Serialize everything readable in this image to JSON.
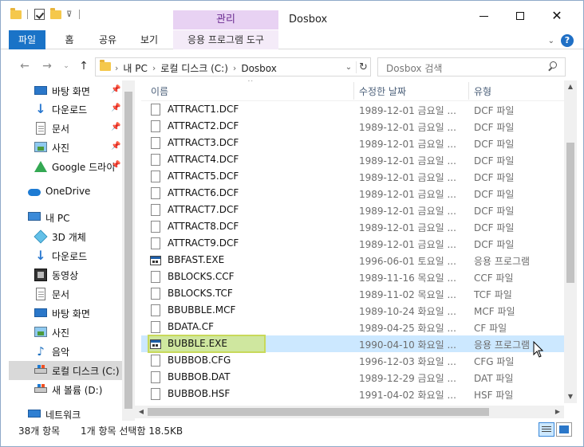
{
  "window": {
    "title": "Dosbox",
    "context_group": "관리"
  },
  "ribbon": {
    "tabs": [
      {
        "label": "파일",
        "active": true
      },
      {
        "label": "홈"
      },
      {
        "label": "공유"
      },
      {
        "label": "보기"
      },
      {
        "label": "응용 프로그램 도구"
      }
    ]
  },
  "address": {
    "crumbs": [
      "내 PC",
      "로컬 디스크 (C:)",
      "Dosbox"
    ]
  },
  "search": {
    "placeholder": "Dosbox 검색"
  },
  "navpane": {
    "quick_access": [
      {
        "label": "바탕 화면",
        "icon": "desktop-icon",
        "pinned": true
      },
      {
        "label": "다운로드",
        "icon": "download-icon",
        "pinned": true
      },
      {
        "label": "문서",
        "icon": "document-icon",
        "pinned": true
      },
      {
        "label": "사진",
        "icon": "picture-icon",
        "pinned": true
      },
      {
        "label": "Google 드라이",
        "icon": "google-drive-icon",
        "pinned": true
      }
    ],
    "onedrive": {
      "label": "OneDrive",
      "icon": "onedrive-icon"
    },
    "this_pc": {
      "label": "내 PC",
      "icon": "pc-icon"
    },
    "pc_items": [
      {
        "label": "3D 개체",
        "icon": "3d-objects-icon"
      },
      {
        "label": "다운로드",
        "icon": "download-icon"
      },
      {
        "label": "동영상",
        "icon": "video-icon"
      },
      {
        "label": "문서",
        "icon": "document-icon"
      },
      {
        "label": "바탕 화면",
        "icon": "desktop-icon"
      },
      {
        "label": "사진",
        "icon": "picture-icon"
      },
      {
        "label": "음악",
        "icon": "music-icon"
      },
      {
        "label": "로컬 디스크 (C:)",
        "icon": "local-disk-icon",
        "selected": true
      },
      {
        "label": "새 볼륨 (D:)",
        "icon": "drive-icon"
      }
    ],
    "network": {
      "label": "네트워크",
      "icon": "network-icon"
    }
  },
  "columns": {
    "name": "이름",
    "date": "수정한 날짜",
    "type": "유형"
  },
  "files": [
    {
      "name": "ATTRACT1.DCF",
      "date": "1989-12-01 금요일 ...",
      "type": "DCF 파일",
      "icon": "file-icon"
    },
    {
      "name": "ATTRACT2.DCF",
      "date": "1989-12-01 금요일 ...",
      "type": "DCF 파일",
      "icon": "file-icon"
    },
    {
      "name": "ATTRACT3.DCF",
      "date": "1989-12-01 금요일 ...",
      "type": "DCF 파일",
      "icon": "file-icon"
    },
    {
      "name": "ATTRACT4.DCF",
      "date": "1989-12-01 금요일 ...",
      "type": "DCF 파일",
      "icon": "file-icon"
    },
    {
      "name": "ATTRACT5.DCF",
      "date": "1989-12-01 금요일 ...",
      "type": "DCF 파일",
      "icon": "file-icon"
    },
    {
      "name": "ATTRACT6.DCF",
      "date": "1989-12-01 금요일 ...",
      "type": "DCF 파일",
      "icon": "file-icon"
    },
    {
      "name": "ATTRACT7.DCF",
      "date": "1989-12-01 금요일 ...",
      "type": "DCF 파일",
      "icon": "file-icon"
    },
    {
      "name": "ATTRACT8.DCF",
      "date": "1989-12-01 금요일 ...",
      "type": "DCF 파일",
      "icon": "file-icon"
    },
    {
      "name": "ATTRACT9.DCF",
      "date": "1989-12-01 금요일 ...",
      "type": "DCF 파일",
      "icon": "file-icon"
    },
    {
      "name": "BBFAST.EXE",
      "date": "1996-06-01 토요일 ...",
      "type": "응용 프로그램",
      "icon": "application-icon"
    },
    {
      "name": "BBLOCKS.CCF",
      "date": "1989-11-16 목요일 ...",
      "type": "CCF 파일",
      "icon": "file-icon"
    },
    {
      "name": "BBLOCKS.TCF",
      "date": "1989-11-02 목요일 ...",
      "type": "TCF 파일",
      "icon": "file-icon"
    },
    {
      "name": "BBUBBLE.MCF",
      "date": "1989-10-24 화요일 ...",
      "type": "MCF 파일",
      "icon": "file-icon"
    },
    {
      "name": "BDATA.CF",
      "date": "1989-04-25 화요일 ...",
      "type": "CF 파일",
      "icon": "file-icon"
    },
    {
      "name": "BUBBLE.EXE",
      "date": "1990-04-10 화요일 ...",
      "type": "응용 프로그램",
      "icon": "application-icon",
      "selected": true
    },
    {
      "name": "BUBBOB.CFG",
      "date": "1996-12-03 화요일 ...",
      "type": "CFG 파일",
      "icon": "file-icon"
    },
    {
      "name": "BUBBOB.DAT",
      "date": "1989-12-29 금요일 ...",
      "type": "DAT 파일",
      "icon": "file-icon"
    },
    {
      "name": "BUBBOB.HSF",
      "date": "1991-04-02 화요일 ...",
      "type": "HSF 파일",
      "icon": "file-icon"
    }
  ],
  "status": {
    "count": "38개 항목",
    "selection": "1개 항목 선택함 18.5KB"
  },
  "colors": {
    "file_tab": "#1a73c7",
    "context_tab": "#e8d2f3",
    "selection": "#cce8ff",
    "highlight": "#d2e650"
  }
}
